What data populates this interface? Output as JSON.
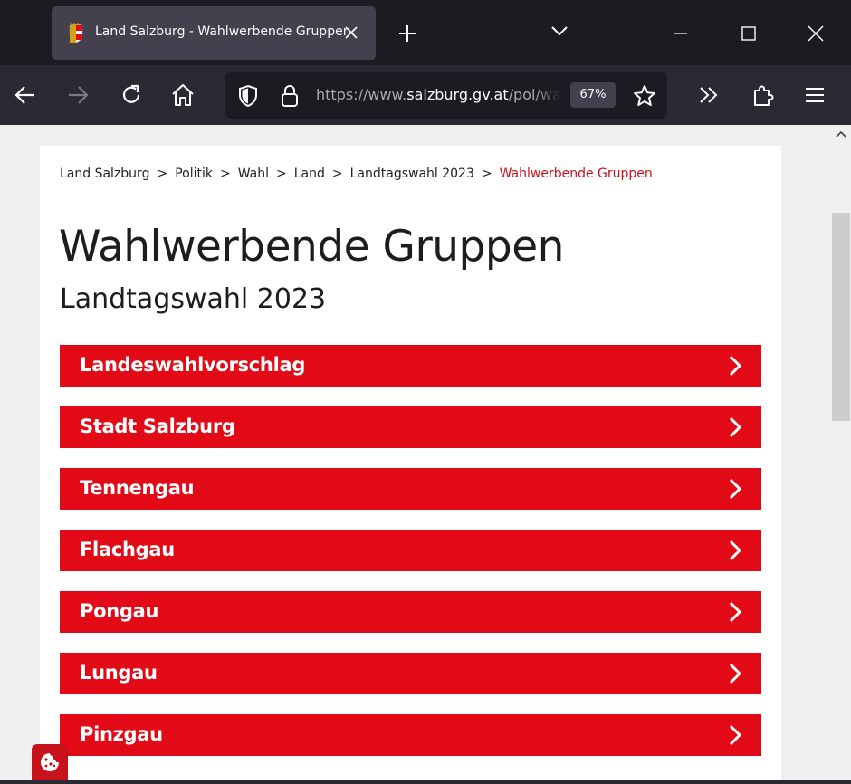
{
  "browser": {
    "tab_title": "Land Salzburg - Wahlwerbende Gruppen",
    "url_prefix": "https://www.",
    "url_domain": "salzburg.gv.at",
    "url_path": "/pol/wahl",
    "zoom": "67%"
  },
  "breadcrumb": {
    "items": [
      "Land Salzburg",
      "Politik",
      "Wahl",
      "Land",
      "Landtagswahl 2023"
    ],
    "current": "Wahlwerbende Gruppen",
    "separator": ">"
  },
  "page": {
    "title": "Wahlwerbende Gruppen",
    "subtitle": "Landtagswahl 2023"
  },
  "groups": [
    {
      "label": "Landeswahlvorschlag"
    },
    {
      "label": "Stadt Salzburg"
    },
    {
      "label": "Tennengau"
    },
    {
      "label": "Flachgau"
    },
    {
      "label": "Pongau"
    },
    {
      "label": "Lungau"
    },
    {
      "label": "Pinzgau"
    }
  ],
  "colors": {
    "accent_red": "#e20a16",
    "breadcrumb_current": "#cc1016",
    "toolbar_bg": "#2b2a33",
    "tabstrip_bg": "#1c1b22"
  },
  "icons": {
    "back": "arrow-left-icon",
    "forward": "arrow-right-icon",
    "reload": "reload-icon",
    "home": "home-icon",
    "shield": "shield-icon",
    "lock": "lock-icon",
    "star": "star-icon",
    "overflow": "double-chevron-icon",
    "extensions": "puzzle-icon",
    "menu": "hamburger-icon",
    "cookie": "cookie-icon"
  }
}
